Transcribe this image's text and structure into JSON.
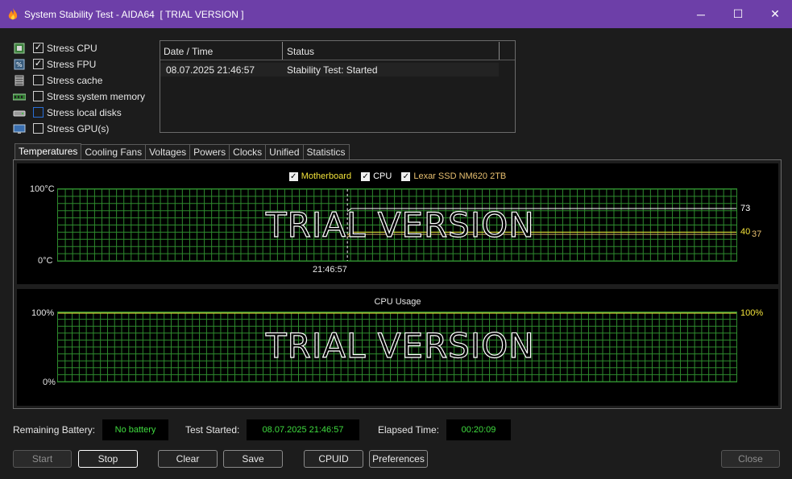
{
  "window": {
    "title": "System Stability Test - AIDA64  [ TRIAL VERSION ]",
    "minimize": "─",
    "maximize": "☐",
    "close": "✕"
  },
  "stress": {
    "items": [
      {
        "label": "Stress CPU",
        "checked": true,
        "icon": "cpu-icon"
      },
      {
        "label": "Stress FPU",
        "checked": true,
        "icon": "fpu-icon"
      },
      {
        "label": "Stress cache",
        "checked": false,
        "icon": "cache-icon"
      },
      {
        "label": "Stress system memory",
        "checked": false,
        "icon": "memory-icon"
      },
      {
        "label": "Stress local disks",
        "checked": false,
        "icon": "disk-icon"
      },
      {
        "label": "Stress GPU(s)",
        "checked": false,
        "icon": "gpu-icon"
      }
    ]
  },
  "log": {
    "col_datetime": "Date / Time",
    "col_status": "Status",
    "rows": [
      {
        "datetime": "08.07.2025 21:46:57",
        "status": "Stability Test: Started"
      }
    ]
  },
  "tabs": [
    "Temperatures",
    "Cooling Fans",
    "Voltages",
    "Powers",
    "Clocks",
    "Unified",
    "Statistics"
  ],
  "active_tab": "Temperatures",
  "temp_graph": {
    "legend": [
      {
        "label": "Motherboard",
        "color": "#f2e23a",
        "checked": true
      },
      {
        "label": "CPU",
        "color": "#ffffff",
        "checked": true
      },
      {
        "label": "Lexar SSD NM620 2TB",
        "color": "#e8c070",
        "checked": true
      }
    ],
    "y_max_label": "100°C",
    "y_min_label": "0°C",
    "time_label": "21:46:57",
    "watermark": "TRIAL VERSION",
    "val_cpu": "73",
    "val_mb": "40",
    "val_ssd": "37",
    "y_max": 100,
    "y_min": 0,
    "cpu_level": 73,
    "mb_level": 40,
    "ssd_level": 37
  },
  "cpu_graph": {
    "title": "CPU Usage",
    "y_max_label": "100%",
    "y_min_label": "0%",
    "current_label": "100%",
    "watermark": "TRIAL VERSION",
    "usage_level": 100
  },
  "info": {
    "battery_label": "Remaining Battery:",
    "battery_value": "No battery",
    "started_label": "Test Started:",
    "started_value": "08.07.2025 21:46:57",
    "elapsed_label": "Elapsed Time:",
    "elapsed_value": "00:20:09"
  },
  "buttons": {
    "start": "Start",
    "stop": "Stop",
    "clear": "Clear",
    "save": "Save",
    "cpuid": "CPUID",
    "preferences": "Preferences",
    "close": "Close"
  },
  "colors": {
    "titlebar": "#6d3fa8",
    "grid": "#2e8b2e",
    "cpu_line": "#ffffff",
    "mb_line": "#f2e23a",
    "ssd_line": "#e8c070",
    "usage_label": "#f2e23a",
    "value_green": "#3fdc3f"
  }
}
